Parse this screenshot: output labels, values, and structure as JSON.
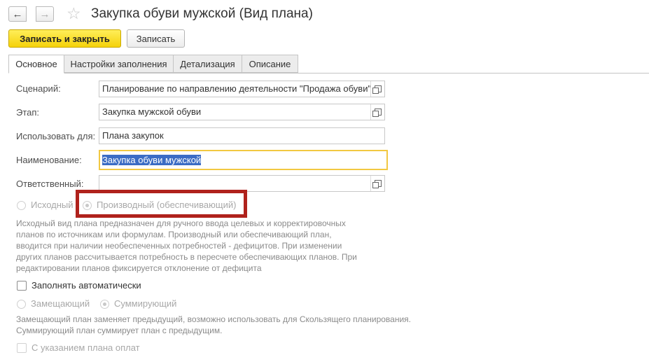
{
  "window": {
    "title": "Закупка обуви мужской (Вид плана)",
    "back_glyph": "←",
    "forward_glyph": "→",
    "star_glyph": "☆"
  },
  "toolbar": {
    "save_close_label": "Записать и закрыть",
    "save_label": "Записать"
  },
  "tabs": [
    {
      "label": "Основное",
      "active": true
    },
    {
      "label": "Настройки заполнения",
      "active": false
    },
    {
      "label": "Детализация",
      "active": false
    },
    {
      "label": "Описание",
      "active": false
    }
  ],
  "form": {
    "scenario_label": "Сценарий:",
    "scenario_value": "Планирование по направлению деятельности \"Продажа обуви\"",
    "stage_label": "Этап:",
    "stage_value": "Закупка мужской обуви",
    "use_for_label": "Использовать для:",
    "use_for_value": "Плана закупок",
    "name_label": "Наименование:",
    "name_value": "Закупка обуви мужской",
    "responsible_label": "Ответственный:",
    "responsible_value": ""
  },
  "plan_kind": {
    "option_source": "Исходный",
    "option_derived": "Производный (обеспечивающий)",
    "selected": "option_derived",
    "hint": "Исходный вид плана предназначен для ручного ввода целевых и корректировочных\nпланов по источникам или формулам. Производный или обеспечивающий план,\nвводится при наличии необеспеченных потребностей - дефицитов. При изменении\nдругих планов рассчитывается потребность в пересчете обеспечивающих планов. При\nредактировании планов фиксируется отклонение от дефицита"
  },
  "auto_fill": {
    "label": "Заполнять автоматически",
    "checked": false
  },
  "fill_mode": {
    "option_replace": "Замещающий",
    "option_sum": "Суммирующий",
    "selected": "option_sum",
    "hint": "Замещающий план заменяет предыдущий, возможно использовать для Скользящего планирования.\nСуммирующий план суммирует план с предыдущим."
  },
  "payment_plan": {
    "label": "С указанием плана оплат",
    "checked": false
  },
  "colors": {
    "accent_yellow": "#f5d20a",
    "focus_border": "#f2c842",
    "highlight_red": "#b0221c",
    "selection_blue": "#3b6cc4"
  },
  "icons": {
    "open_icon": "open-in-new-window-icon"
  }
}
